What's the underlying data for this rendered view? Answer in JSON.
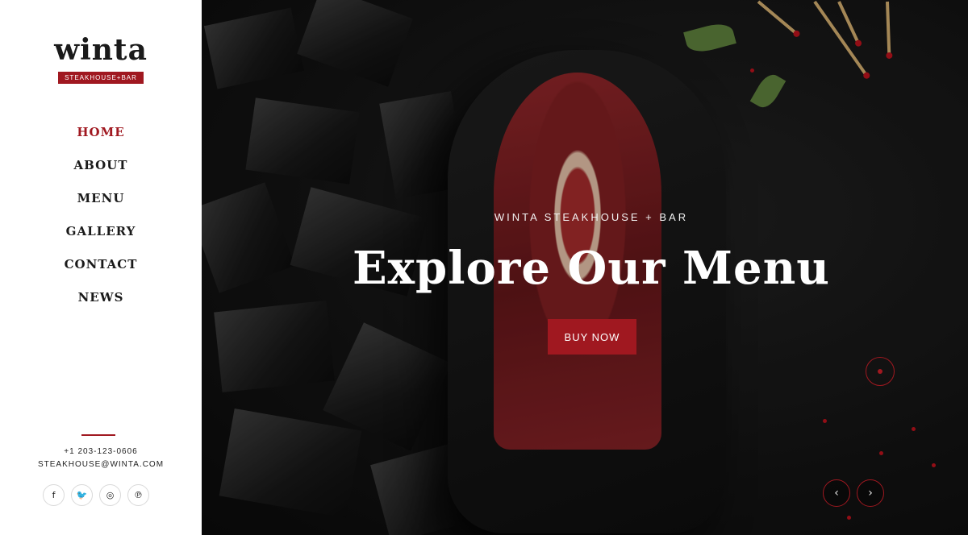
{
  "brand": {
    "name": "winta",
    "tagline": "STEAKHOUSE+BAR"
  },
  "nav": {
    "items": [
      "HOME",
      "ABOUT",
      "MENU",
      "GALLERY",
      "CONTACT",
      "NEWS"
    ],
    "active": "HOME"
  },
  "contact": {
    "phone": "+1 203-123-0606",
    "email": "STEAKHOUSE@WINTA.COM"
  },
  "socials": [
    {
      "name": "facebook-icon",
      "glyph": "f"
    },
    {
      "name": "twitter-icon",
      "glyph": "🐦"
    },
    {
      "name": "instagram-icon",
      "glyph": "◎"
    },
    {
      "name": "pinterest-icon",
      "glyph": "℗"
    }
  ],
  "hero": {
    "subtitle": "WINTA STEAKHOUSE + BAR",
    "headline": "Explore Our Menu",
    "cta_label": "BUY NOW",
    "prev_glyph": "‹",
    "next_glyph": "›"
  },
  "colors": {
    "accent": "#a01820",
    "sidebar_bg": "#ffffff",
    "hero_bg": "#111111"
  }
}
